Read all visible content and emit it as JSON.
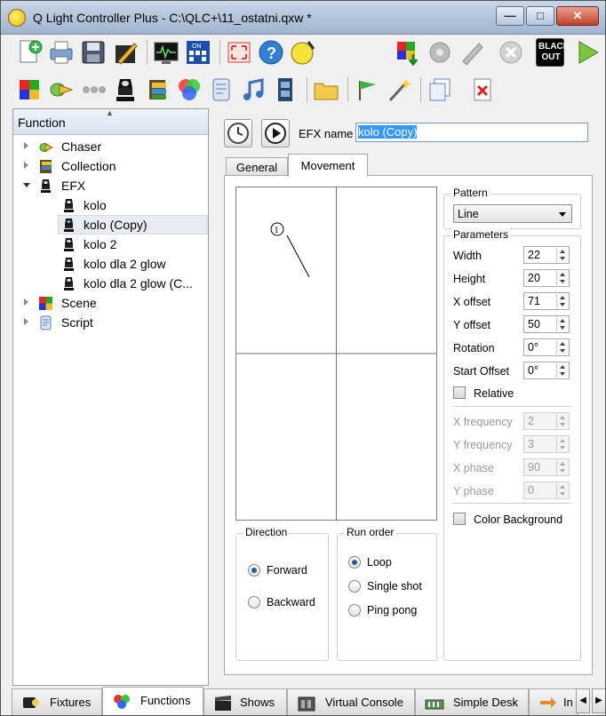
{
  "window": {
    "title": "Q Light Controller Plus - C:\\QLC+\\11_ostatni.qxw *",
    "minimize_glyph": "—",
    "maximize_glyph": "□",
    "close_glyph": "✕"
  },
  "toolbar_top": {
    "blackout_label": "BLACK OUT",
    "icons": [
      "new-project-icon",
      "print-icon",
      "save-icon",
      "edit-icon",
      "monitor-icon",
      "dmx-address-icon",
      "fullscreen-icon",
      "help-icon",
      "about-icon",
      "dump-icon",
      "stop-all-icon",
      "live-edit-icon",
      "close-icon",
      "blackout-icon",
      "operate-mode-icon"
    ]
  },
  "toolbar_functions": {
    "icons": [
      "new-scene-icon",
      "new-chaser-icon",
      "new-sequence-icon",
      "new-efx-icon",
      "new-collection-icon",
      "new-rgb-matrix-icon",
      "new-script-icon",
      "new-audio-icon",
      "new-video-icon",
      "new-folder-icon",
      "wizard-icon",
      "magic-icon",
      "clone-icon",
      "delete-icon"
    ]
  },
  "sidebar": {
    "header": "Function",
    "tree": [
      {
        "label": "Chaser",
        "icon": "chaser-icon",
        "expanded": false
      },
      {
        "label": "Collection",
        "icon": "collection-icon",
        "expanded": false
      },
      {
        "label": "EFX",
        "icon": "efx-icon",
        "expanded": true,
        "children": [
          "kolo",
          "kolo (Copy)",
          "kolo 2",
          "kolo dla 2 glow",
          "kolo dla 2 glow (C..."
        ]
      },
      {
        "label": "Scene",
        "icon": "scene-icon",
        "expanded": false
      },
      {
        "label": "Script",
        "icon": "script-icon",
        "expanded": false
      }
    ],
    "selected": "kolo (Copy)"
  },
  "editor": {
    "efx_name_label": "EFX name",
    "efx_name_value": "kolo (Copy)",
    "tabs": [
      "General",
      "Movement"
    ],
    "active_tab": "Movement",
    "preview_marker": "1",
    "direction": {
      "title": "Direction",
      "options": [
        "Forward",
        "Backward"
      ],
      "selected": "Forward"
    },
    "run_order": {
      "title": "Run order",
      "options": [
        "Loop",
        "Single shot",
        "Ping pong"
      ],
      "selected": "Loop"
    },
    "pattern": {
      "title": "Pattern",
      "value": "Line"
    },
    "parameters": {
      "title": "Parameters",
      "fields": [
        {
          "label": "Width",
          "value": "22",
          "enabled": true
        },
        {
          "label": "Height",
          "value": "20",
          "enabled": true
        },
        {
          "label": "X offset",
          "value": "71",
          "enabled": true
        },
        {
          "label": "Y offset",
          "value": "50",
          "enabled": true
        },
        {
          "label": "Rotation",
          "value": "0°",
          "enabled": true
        },
        {
          "label": "Start Offset",
          "value": "0°",
          "enabled": true
        }
      ],
      "relative_label": "Relative",
      "relative_checked": false,
      "freq_fields": [
        {
          "label": "X frequency",
          "value": "2",
          "enabled": false
        },
        {
          "label": "Y frequency",
          "value": "3",
          "enabled": false
        },
        {
          "label": "X phase",
          "value": "90",
          "enabled": false
        },
        {
          "label": "Y phase",
          "value": "0",
          "enabled": false
        }
      ],
      "color_background_label": "Color Background",
      "color_background_checked": false
    }
  },
  "bottom_tabs": {
    "items": [
      {
        "label": "Fixtures",
        "icon": "fixtures-icon"
      },
      {
        "label": "Functions",
        "icon": "functions-icon"
      },
      {
        "label": "Shows",
        "icon": "shows-icon"
      },
      {
        "label": "Virtual Console",
        "icon": "virtual-console-icon"
      },
      {
        "label": "Simple Desk",
        "icon": "simple-desk-icon"
      },
      {
        "label": "In",
        "icon": "inputs-outputs-icon"
      }
    ],
    "active": "Functions"
  },
  "colors": {
    "selection": "#3399ff",
    "radio_dot": "#1e5fa3",
    "title_gradient_top": "#c8d6e8"
  }
}
